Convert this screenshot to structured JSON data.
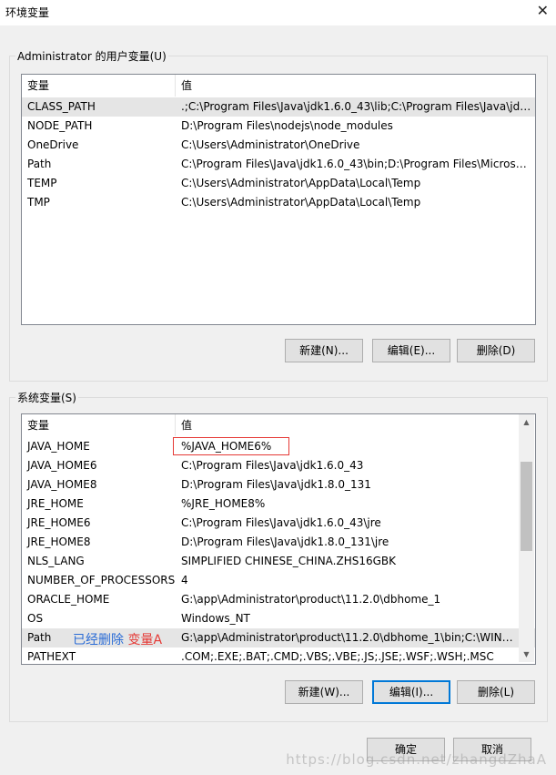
{
  "window": {
    "title": "环境变量",
    "close_glyph": "✕"
  },
  "user_vars": {
    "group_label": "Administrator 的用户变量(U)",
    "col_name": "变量",
    "col_value": "值",
    "rows": [
      {
        "name": "CLASS_PATH",
        "value": ".;C:\\Program Files\\Java\\jdk1.6.0_43\\lib;C:\\Program Files\\Java\\jdk..."
      },
      {
        "name": "NODE_PATH",
        "value": "D:\\Program Files\\nodejs\\node_modules"
      },
      {
        "name": "OneDrive",
        "value": "C:\\Users\\Administrator\\OneDrive"
      },
      {
        "name": "Path",
        "value": "C:\\Program Files\\Java\\jdk1.6.0_43\\bin;D:\\Program Files\\Microso..."
      },
      {
        "name": "TEMP",
        "value": "C:\\Users\\Administrator\\AppData\\Local\\Temp"
      },
      {
        "name": "TMP",
        "value": "C:\\Users\\Administrator\\AppData\\Local\\Temp"
      }
    ],
    "buttons": {
      "new": "新建(N)...",
      "edit": "编辑(E)...",
      "delete": "删除(D)"
    }
  },
  "sys_vars": {
    "group_label": "系统变量(S)",
    "col_name": "变量",
    "col_value": "值",
    "rows": [
      {
        "name": "JAVA_HOME",
        "value": "%JAVA_HOME6%"
      },
      {
        "name": "JAVA_HOME6",
        "value": "C:\\Program Files\\Java\\jdk1.6.0_43"
      },
      {
        "name": "JAVA_HOME8",
        "value": "D:\\Program Files\\Java\\jdk1.8.0_131"
      },
      {
        "name": "JRE_HOME",
        "value": "%JRE_HOME8%"
      },
      {
        "name": "JRE_HOME6",
        "value": "C:\\Program Files\\Java\\jdk1.6.0_43\\jre"
      },
      {
        "name": "JRE_HOME8",
        "value": "D:\\Program Files\\Java\\jdk1.8.0_131\\jre"
      },
      {
        "name": "NLS_LANG",
        "value": "SIMPLIFIED CHINESE_CHINA.ZHS16GBK"
      },
      {
        "name": "NUMBER_OF_PROCESSORS",
        "value": "4"
      },
      {
        "name": "ORACLE_HOME",
        "value": "G:\\app\\Administrator\\product\\11.2.0\\dbhome_1"
      },
      {
        "name": "OS",
        "value": "Windows_NT"
      },
      {
        "name": "Path",
        "value": "G:\\app\\Administrator\\product\\11.2.0\\dbhome_1\\bin;C:\\WIND..."
      },
      {
        "name": "PATHEXT",
        "value": ".COM;.EXE;.BAT;.CMD;.VBS;.VBE;.JS;.JSE;.WSF;.WSH;.MSC"
      }
    ],
    "buttons": {
      "new": "新建(W)...",
      "edit": "编辑(I)...",
      "delete": "删除(L)"
    }
  },
  "annotation": {
    "deleted_text": "已经删除",
    "var_text": "变量A"
  },
  "footer": {
    "ok": "确定",
    "cancel": "取消"
  },
  "watermark": "https://blog.csdn.net/zhangdZhaA",
  "colors": {
    "highlight_box": "#e53935",
    "annotation_blue": "#2b6cd6",
    "focus_border": "#0078d7"
  }
}
